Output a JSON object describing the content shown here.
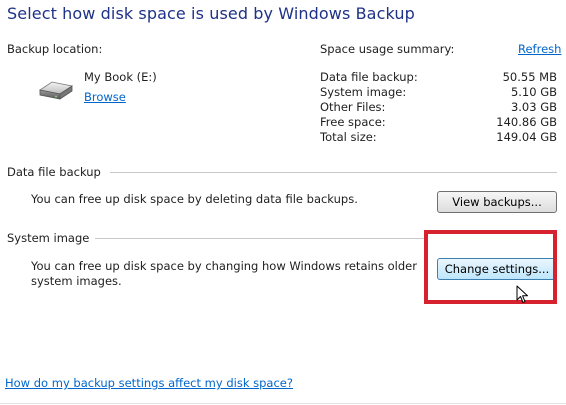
{
  "page": {
    "title": "Select how disk space is used by Windows Backup"
  },
  "backup_location": {
    "label": "Backup location:",
    "drive_name": "My Book (E:)",
    "browse_link": "Browse",
    "drive_icon": "external-drive-icon"
  },
  "summary": {
    "label": "Space usage summary:",
    "refresh_link": "Refresh",
    "rows": [
      {
        "key": "Data file backup:",
        "value": "50.55 MB"
      },
      {
        "key": "System image:",
        "value": "5.10 GB"
      },
      {
        "key": "Other Files:",
        "value": "3.03 GB"
      },
      {
        "key": "Free space:",
        "value": "140.86 GB"
      },
      {
        "key": "Total size:",
        "value": "149.04 GB"
      }
    ]
  },
  "data_file_backup": {
    "heading": "Data file backup",
    "description": "You can free up disk space by deleting data file backups.",
    "button": "View backups..."
  },
  "system_image": {
    "heading": "System image",
    "description_line1": "You can free up disk space by changing how Windows retains older",
    "description_line2": "system images.",
    "button": "Change settings..."
  },
  "footer": {
    "help_link": "How do my backup settings affect my disk space?"
  },
  "colors": {
    "title": "#1e3287",
    "link": "#0066cc",
    "highlight": "#d6212f"
  }
}
